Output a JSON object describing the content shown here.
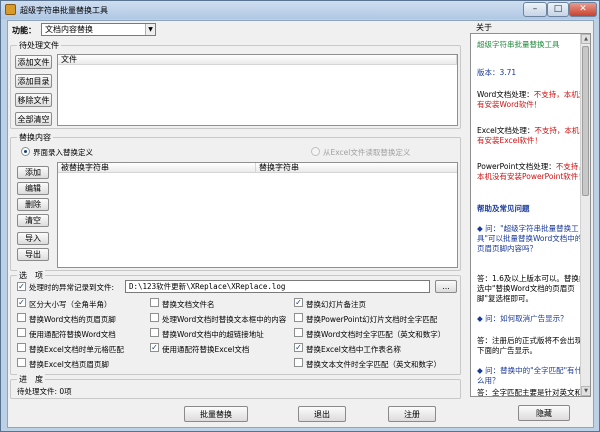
{
  "window": {
    "title": "超级字符串批量替换工具"
  },
  "function": {
    "label": "功能：",
    "value": "文档内容替换"
  },
  "pending": {
    "title": "待处理文件",
    "buttons": [
      "添加文件",
      "添加目录",
      "移除文件",
      "全部清空"
    ],
    "column": "文件"
  },
  "replace": {
    "title": "替换内容",
    "radio1": "界面录入替换定义",
    "radio2": "从Excel文件读取替换定义",
    "buttons": [
      "添加",
      "编辑",
      "删除",
      "清空",
      "导入",
      "导出"
    ],
    "col1": "被替换字符串",
    "col2": "替换字符串"
  },
  "options": {
    "title": "选　项",
    "log_label": "处理时的异常记录到文件:",
    "log_path": "D:\\123软件更新\\XReplace\\XReplace.log",
    "browse": "...",
    "items": [
      [
        "区分大小写（全角半角）",
        "替换文档文件名",
        "替换幻灯片备注页"
      ],
      [
        "替换Word文档的页眉页脚",
        "处理Word文档时替换文本框中的内容",
        "替换PowerPoint幻灯片文档时全字匹配"
      ],
      [
        "使用通配符替换Word文档",
        "替换Word文档中的超链接地址",
        "替换Word文档时全字匹配（英文和数字）"
      ],
      [
        "替换Excel文档时单元格匹配",
        "使用通配符替换Excel文档",
        "替换Excel文档中工作表名称"
      ],
      [
        "替换Excel文档页眉页脚",
        "",
        "替换文本文件时全字匹配（英文和数字）"
      ]
    ]
  },
  "progress": {
    "title": "进　度",
    "text": "待处理文件: 0项"
  },
  "footer": {
    "batch": "批量替换",
    "exit": "退出",
    "register": "注册",
    "hide": "隐藏"
  },
  "about": {
    "title": "关于",
    "app_name": "超级字符串批量替换工具",
    "version": "版本：3.71",
    "word_label": "Word文档处理：",
    "word_status": "不支持，本机没有安装Word软件！",
    "excel_label": "Excel文档处理：",
    "excel_status": "不支持，本机没有安装Excel软件！",
    "ppt_label": "PowerPoint文档处理：",
    "ppt_status": "不支持，本机没有安装PowerPoint软件！",
    "faq_title": "帮助及常见问题",
    "q1": "问：\"超级字符串批量替换工具\"可以批量替换Word文档中的页眉页脚内容吗？",
    "a1": "答：1.6及以上版本可以。替换前选中\"替换Word文档的页眉页脚\"复选框即可。",
    "q2": "问：如何取消广告显示？",
    "a2": "答：注册后的正式版将不会出现下面的广告显示。",
    "q3": "问：替换中的\"全字匹配\"有什么用？",
    "a3": "答：全字匹配主要是针对英文和数字的，指在有效的"
  },
  "colors": {
    "accent_green": "#1f8a3a",
    "link_blue": "#1a3a9a",
    "warn_red": "#d01010"
  }
}
